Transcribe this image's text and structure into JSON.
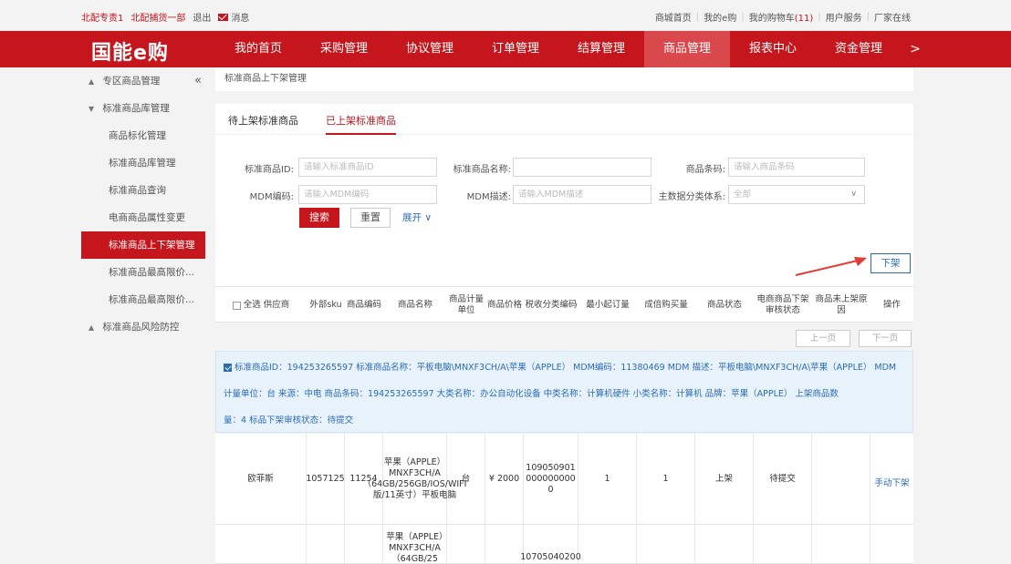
{
  "topbar": {
    "user": "北配专责1",
    "dept": "北配捕货一部",
    "logout": "退出",
    "messages": "消息",
    "links": [
      "商城首页",
      "我的e购",
      "我的购物车"
    ],
    "cart_count": "(11)",
    "links2": [
      "用户服务",
      "厂家在线"
    ]
  },
  "logo": "国能e购",
  "nav": {
    "items": [
      "我的首页",
      "采购管理",
      "协议管理",
      "订单管理",
      "结算管理",
      "商品管理",
      "报表中心",
      "资金管理"
    ],
    "active_index": 5,
    "more": ">"
  },
  "sidebar": {
    "collapse": "«",
    "items": [
      {
        "label": "专区商品管理",
        "type": "group",
        "tri": "▲"
      },
      {
        "label": "标准商品库管理",
        "type": "group",
        "tri": "▼"
      },
      {
        "label": "商品标化管理",
        "type": "sub"
      },
      {
        "label": "标准商品库管理",
        "type": "sub"
      },
      {
        "label": "标准商品查询",
        "type": "sub"
      },
      {
        "label": "电商商品属性变更",
        "type": "sub"
      },
      {
        "label": "标准商品上下架管理",
        "type": "sub",
        "active": true
      },
      {
        "label": "标准商品最高限价...",
        "type": "sub"
      },
      {
        "label": "标准商品最高限价...",
        "type": "sub"
      },
      {
        "label": "标准商品风险防控",
        "type": "group",
        "tri": "▲"
      }
    ]
  },
  "breadcrumb": "标准商品上下架管理",
  "tabs": [
    "待上架标准商品",
    "已上架标准商品"
  ],
  "filters": {
    "std_id_label": "标准商品ID:",
    "std_id_placeholder": "请输入标准商品ID",
    "std_name_label": "标准商品名称:",
    "barcode_label": "商品条码:",
    "barcode_placeholder": "请输入商品条码",
    "mdm_code_label": "MDM编码:",
    "mdm_code_placeholder": "请输入MDM编码",
    "mdm_desc_label": "MDM描述:",
    "mdm_desc_placeholder": "请输入MDM描述",
    "category_label": "主数据分类体系:",
    "category_value": "全部"
  },
  "buttons": {
    "search": "搜索",
    "reset": "重置",
    "expand": "展开 ∨",
    "take_down": "下架",
    "prev": "上一页",
    "next": "下一页"
  },
  "table": {
    "headers": [
      "全选 供应商",
      "外部sku",
      "商品编码",
      "商品名称",
      "商品计量单位",
      "商品价格",
      "税收分类编码",
      "最小起订量",
      "成倍购买量",
      "商品状态",
      "电商商品下架审核状态",
      "商品未上架原因",
      "操作"
    ]
  },
  "detail": {
    "line1": "标准商品ID：194253265597    标准商品名称：平板电脑\\MNXF3CH/A\\苹果（APPLE）    MDM编码：11380469    MDM 描述：平板电脑\\MNXF3CH/A\\苹果（APPLE）    MDM",
    "line2": "计量单位：台    来源：中电    商品条码：194253265597    大类名称：办公自动化设备    中类名称：计算机硬件    小类名称：计算机    品牌：苹果（APPLE）    上架商品数",
    "line3": "量：4    标品下架审核状态：待提交"
  },
  "rows": [
    {
      "supplier": "欧菲斯",
      "sku": "1057125",
      "code": "11254",
      "name": "苹果（APPLE）MNXF3CH/A（64GB/256GB/IOS/WIFI版/11英寸）平板电脑",
      "unit": "台",
      "price": "¥ 2000",
      "tax_code": "1090509010000000000",
      "min_order": "1",
      "multiple": "1",
      "status": "上架",
      "audit": "待提交",
      "reason": "",
      "action": "手动下架"
    },
    {
      "supplier": "",
      "sku": "",
      "code": "",
      "name": "苹果（APPLE）MNXF3CH/A（64GB/25",
      "unit": "",
      "price": "",
      "tax_code": "10705040200",
      "min_order": "",
      "multiple": "",
      "status": "",
      "audit": "",
      "reason": "",
      "action": ""
    }
  ],
  "colors": {
    "brand": "#c4161c",
    "link": "#2b6cb5"
  }
}
